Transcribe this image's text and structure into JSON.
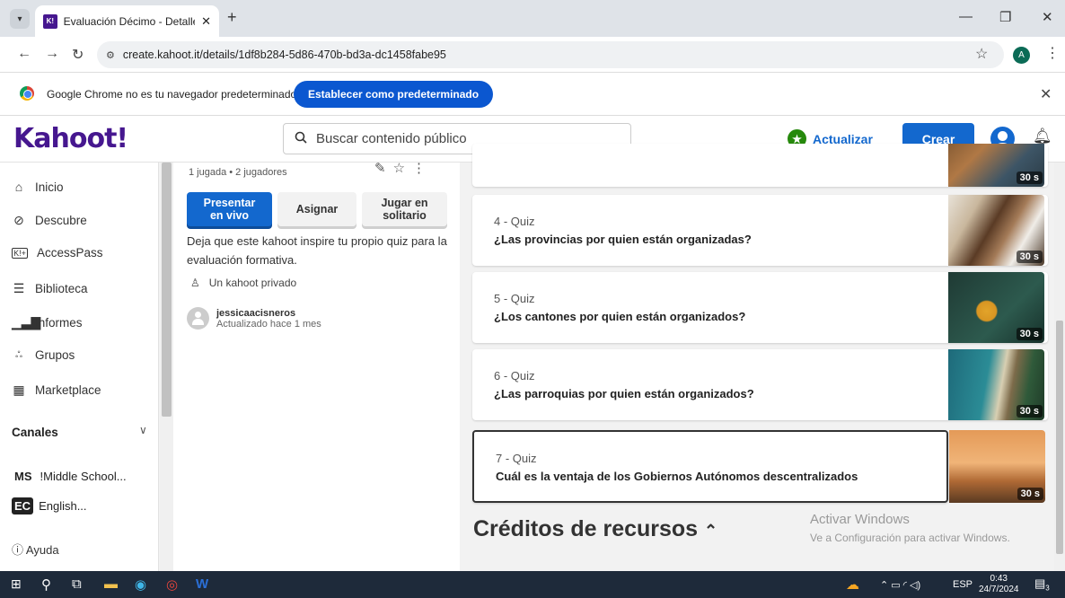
{
  "browser": {
    "tab_title": "Evaluación Décimo - Detalles - Kahoot!",
    "url": "create.kahoot.it/details/1df8b284-5d86-470b-bd3a-dc1458fabe95",
    "profile_initial": "A"
  },
  "infobar": {
    "message": "Google Chrome no es tu navegador predeterminado",
    "button": "Establecer como predeterminado"
  },
  "header": {
    "logo": "Kahoot!",
    "search_placeholder": "Buscar contenido público",
    "upgrade": "Actualizar",
    "create": "Crear"
  },
  "sidebar": {
    "items": [
      {
        "label": "Inicio",
        "icon": "home-icon"
      },
      {
        "label": "Descubre",
        "icon": "compass-icon"
      },
      {
        "label": "AccessPass",
        "icon": "k-plus-icon"
      },
      {
        "label": "Biblioteca",
        "icon": "list-icon"
      },
      {
        "label": "Informes",
        "icon": "bar-chart-icon"
      },
      {
        "label": "Grupos",
        "icon": "group-icon"
      },
      {
        "label": "Marketplace",
        "icon": "store-icon"
      }
    ],
    "channels_title": "Canales",
    "channels": [
      {
        "badge": "MS",
        "label": "!Middle School..."
      },
      {
        "badge": "EC",
        "label": "English..."
      }
    ],
    "help": "Ayuda"
  },
  "details": {
    "stats": "1 jugada • 2 jugadores",
    "present": "Presentar en vivo",
    "assign": "Asignar",
    "solo": "Jugar en solitario",
    "description": "Deja que este kahoot inspire tu propio quiz para la evaluación formativa.",
    "privacy": "Un kahoot privado",
    "author": "jessicaacisneros",
    "updated": "Actualizado hace 1 mes"
  },
  "questions": [
    {
      "num": "4 - Quiz",
      "title": "¿Las provincias por quien están organizadas?",
      "time": "30 s"
    },
    {
      "num": "5 - Quiz",
      "title": "¿Los cantones por quien están organizados?",
      "time": "30 s"
    },
    {
      "num": "6 - Quiz",
      "title": "¿Las parroquias por quien están organizados?",
      "time": "30 s"
    },
    {
      "num": "7 - Quiz",
      "title": "Cuál es la ventaja de los Gobiernos Autónomos descentralizados",
      "time": "30 s"
    }
  ],
  "prev_time": "30 s",
  "credits_title": "Créditos de recursos",
  "watermark": {
    "line1": "Activar Windows",
    "line2": "Ve a Configuración para activar Windows."
  },
  "taskbar": {
    "lang": "ESP",
    "time": "0:43",
    "date": "24/7/2024",
    "notif": "3"
  }
}
